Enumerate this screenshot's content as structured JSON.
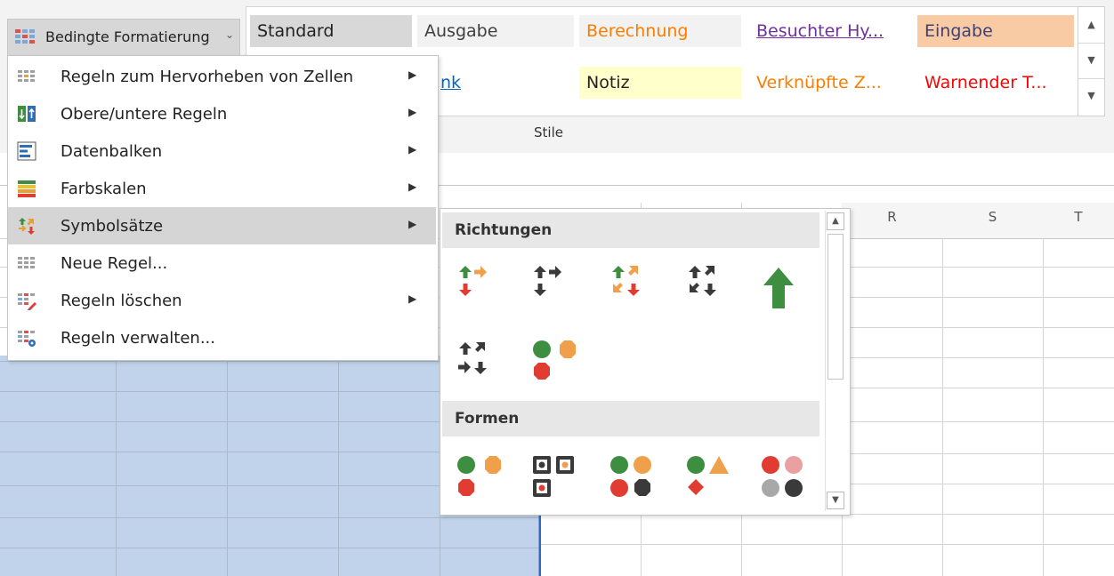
{
  "ribbon": {
    "cf_button_label": "Bedingte Formatierung",
    "group_label": "Stile",
    "styles_row1": [
      {
        "label": "Standard",
        "color": "#222222",
        "bg": "#d8d8d8",
        "underline": false
      },
      {
        "label": "Ausgabe",
        "color": "#3f3f3f",
        "bg": "#f2f2f2",
        "underline": false
      },
      {
        "label": "Berechnung",
        "color": "#fa7d00",
        "bg": "#f2f2f2",
        "underline": false
      },
      {
        "label": "Besuchter Hy...",
        "color": "#7030a0",
        "bg": "#ffffff",
        "underline": true
      },
      {
        "label": "Eingabe",
        "color": "#3f3f76",
        "bg": "#f8cba4",
        "underline": false
      }
    ],
    "styles_row2": [
      {
        "label": "nk",
        "color": "#0563c1",
        "bg": "#ffffff",
        "underline": true
      },
      {
        "label": "Notiz",
        "color": "#222222",
        "bg": "#ffffcc",
        "underline": false
      },
      {
        "label": "Verknüpfte Z...",
        "color": "#fa7d00",
        "bg": "#ffffff",
        "underline": false
      },
      {
        "label": "Warnender T...",
        "color": "#ff0000",
        "bg": "#ffffff",
        "underline": false
      }
    ]
  },
  "grid": {
    "columns": [
      "R",
      "S",
      "T"
    ]
  },
  "menu": {
    "items": [
      {
        "label": "Regeln zum Hervorheben von Zellen",
        "has_submenu": true,
        "icon": "highlight-rules-icon"
      },
      {
        "label": "Obere/untere Regeln",
        "has_submenu": true,
        "icon": "top-bottom-rules-icon"
      },
      {
        "label": "Datenbalken",
        "has_submenu": true,
        "icon": "data-bars-icon"
      },
      {
        "label": "Farbskalen",
        "has_submenu": true,
        "icon": "color-scales-icon"
      },
      {
        "label": "Symbolsätze",
        "has_submenu": true,
        "icon": "icon-sets-icon"
      },
      {
        "label": "Neue Regel...",
        "has_submenu": false,
        "icon": "new-rule-icon"
      },
      {
        "label": "Regeln löschen",
        "has_submenu": true,
        "icon": "clear-rules-icon"
      },
      {
        "label": "Regeln verwalten...",
        "has_submenu": false,
        "icon": "manage-rules-icon"
      }
    ]
  },
  "submenu": {
    "section1": "Richtungen",
    "section2": "Formen"
  },
  "colors": {
    "green": "#3e8e41",
    "red": "#e03c31",
    "orange": "#f0a04b",
    "dark": "#3a3a3a",
    "selection": "#c0d3ea"
  }
}
